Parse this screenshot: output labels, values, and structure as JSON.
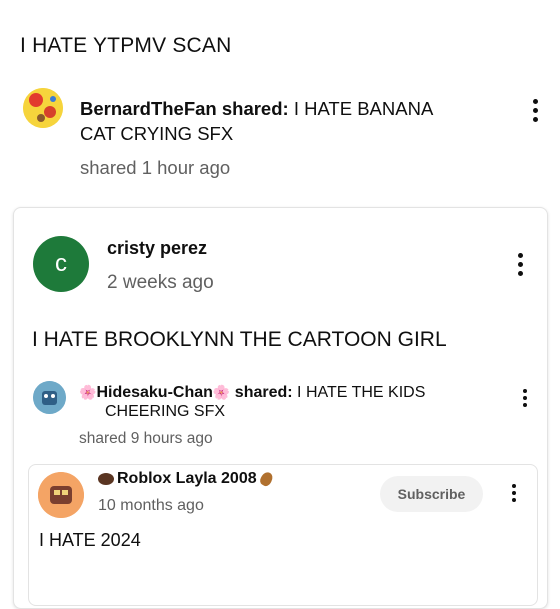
{
  "post": {
    "text": "I HATE YTPMV SCAN",
    "shared_item": {
      "author": "BernardTheFan",
      "shared_label": "shared:",
      "title_line1": "I HATE BANANA",
      "title_line2": "CAT CRYING SFX",
      "time": "shared 1 hour ago"
    }
  },
  "comment": {
    "avatar_letter": "c",
    "author": "cristy perez",
    "time": "2 weeks ago",
    "text": "I HATE BROOKLYNN THE CARTOON GIRL",
    "shared_item": {
      "author_prefix": "🌸",
      "author": "Hidesaku-Chan",
      "author_suffix": "🌸",
      "shared_label": "shared:",
      "title_line1": "I HATE THE KIDS",
      "title_line2": "CHEERING SFX",
      "time": "shared 9 hours ago"
    },
    "nested": {
      "author": "Roblox Layla 2008",
      "time": "10 months ago",
      "text": "I HATE 2024",
      "subscribe_label": "Subscribe"
    }
  },
  "colors": {
    "avatar_green": "#1e7a3a"
  }
}
